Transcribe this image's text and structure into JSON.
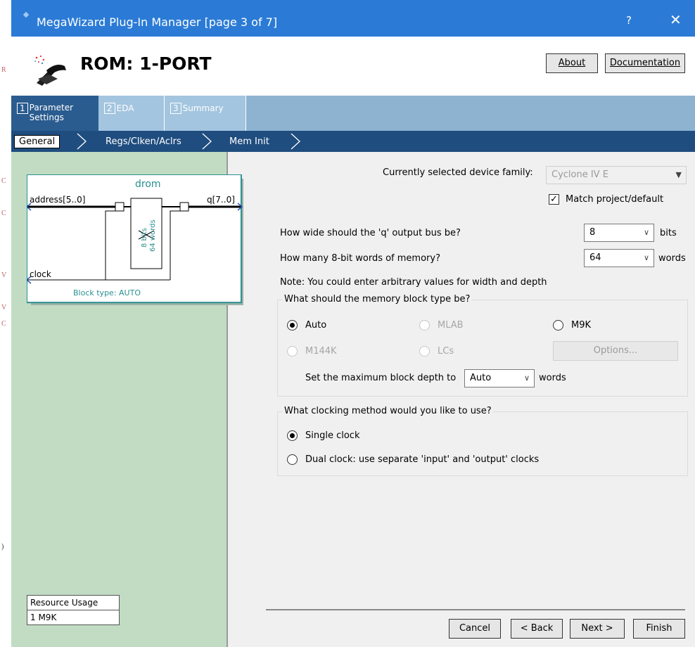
{
  "window": {
    "title": "MegaWizard Plug-In Manager [page 3 of 7]",
    "help_label": "?",
    "close_label": "✕"
  },
  "header": {
    "title": "ROM: 1-PORT",
    "about_label": "About",
    "documentation_label": "Documentation"
  },
  "tabs": [
    {
      "num": "1",
      "label": "Parameter Settings"
    },
    {
      "num": "2",
      "label": "EDA"
    },
    {
      "num": "3",
      "label": "Summary"
    }
  ],
  "breadcrumbs": [
    "General",
    "Regs/Clken/Aclrs",
    "Mem Init"
  ],
  "block": {
    "name": "drom",
    "address": "address[5..0]",
    "q": "q[7..0]",
    "clock": "clock",
    "bits": "8 bits",
    "words": "64 words",
    "type": "Block type: AUTO"
  },
  "resources": {
    "header": "Resource Usage",
    "value": "1 M9K"
  },
  "device": {
    "label": "Currently selected device family:",
    "value": "Cyclone IV E",
    "match_label": "Match project/default",
    "match_checked": true
  },
  "width": {
    "question": "How wide should the 'q' output bus be?",
    "value": "8",
    "unit": "bits"
  },
  "depth": {
    "question": "How many 8-bit words of memory?",
    "value": "64",
    "unit": "words"
  },
  "note": "Note: You could enter arbitrary values for width and depth",
  "memblock": {
    "title": "What should the memory block type be?",
    "options": [
      "Auto",
      "MLAB",
      "M9K",
      "M144K",
      "LCs"
    ],
    "selected": "Auto",
    "options_button": "Options...",
    "max_depth_label": "Set the maximum block depth to",
    "max_depth_value": "Auto",
    "max_depth_unit": "words"
  },
  "clocking": {
    "title": "What clocking method would you like to use?",
    "single": "Single clock",
    "dual": "Dual clock: use separate 'input' and 'output' clocks",
    "selected": "Single clock"
  },
  "footer": {
    "cancel": "Cancel",
    "back": "< Back",
    "next": "Next >",
    "finish": "Finish"
  },
  "colors": {
    "titlebar": "#2b7bd6",
    "tab_active": "#2a5c8f",
    "crumbbar": "#1f4d7f",
    "leftpane": "#c1dcc3",
    "block_teal": "#2a8f8f"
  },
  "icons": [
    "window-icon",
    "wand-icon",
    "checkmark-icon",
    "dropdown-arrow-icon"
  ]
}
